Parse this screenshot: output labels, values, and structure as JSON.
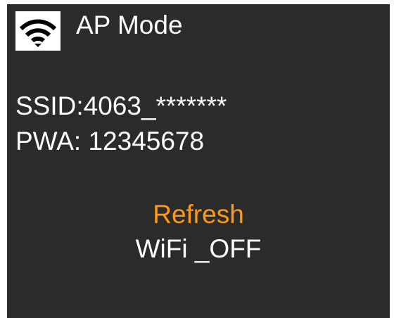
{
  "header": {
    "icon": "wifi-icon",
    "title": "AP Mode"
  },
  "network": {
    "ssid": "SSID:4063_*******",
    "password": "PWA: 12345678"
  },
  "actions": {
    "refresh_label": "Refresh",
    "wifi_off_label": "WiFi _OFF"
  },
  "colors": {
    "screen_background": "#2b2b2b",
    "text": "#ffffff",
    "accent": "#ff9a12"
  }
}
